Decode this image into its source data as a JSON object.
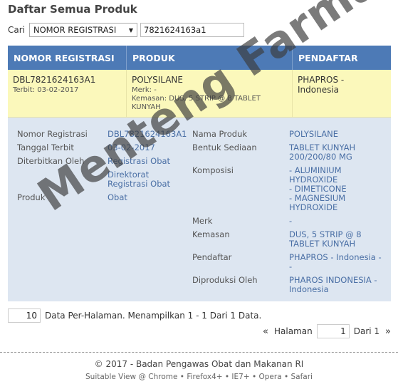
{
  "page_title": "Daftar Semua Produk",
  "search": {
    "label": "Cari",
    "field_selected": "NOMOR REGISTRASI",
    "query": "7821624163a1"
  },
  "table": {
    "headers": [
      "NOMOR REGISTRASI",
      "PRODUK",
      "PENDAFTAR"
    ],
    "row": {
      "reg_no": "DBL7821624163A1",
      "terbit": "Terbit: 03-02-2017",
      "product": "POLYSILANE",
      "merk": "Merk: -",
      "kemasan": "Kemasan: DUS, 5 STRIP @ 8 TABLET KUNYAH",
      "registrant": "PHAPROS -",
      "registrant_country": "Indonesia"
    }
  },
  "detail": {
    "left": {
      "nomor_label": "Nomor Registrasi",
      "nomor_value": "DBL7821624163A1",
      "tanggal_label": "Tanggal Terbit",
      "tanggal_value": "03-02-2017",
      "diterbitkan_label": "Diterbitkan Oleh",
      "diterbitkan_link1": "Registrasi Obat",
      "diterbitkan_link2": "Direktorat Registrasi Obat",
      "produk_label": "Produk",
      "produk_value": "Obat"
    },
    "right": {
      "nama_label": "Nama Produk",
      "nama_value": "POLYSILANE",
      "bentuk_label": "Bentuk Sediaan",
      "bentuk_value": "TABLET KUNYAH 200/200/80 MG",
      "komposisi_label": "Komposisi",
      "komposisi_1": "- ALUMINIUM HYDROXIDE",
      "komposisi_2": "- DIMETICONE",
      "komposisi_3": "- MAGNESIUM HYDROXIDE",
      "merk_label": "Merk",
      "merk_value": "-",
      "kemasan_label": "Kemasan",
      "kemasan_value": "DUS, 5 STRIP @ 8 TABLET KUNYAH",
      "pendaftar_label": "Pendaftar",
      "pendaftar_value": "PHAPROS - Indonesia - -",
      "diproduksi_label": "Diproduksi Oleh",
      "diproduksi_value": "PHAROS INDONESIA - Indonesia"
    }
  },
  "pagination": {
    "per_page": "10",
    "info": "Data Per-Halaman. Menampilkan 1 - 1 Dari 1 Data.",
    "prev": "«",
    "halaman_label": "Halaman",
    "current": "1",
    "of": "Dari 1",
    "next": "»"
  },
  "footer": {
    "line1": "© 2017 - Badan Pengawas Obat dan Makanan RI",
    "line2": "Suitable View @ Chrome • Firefox4+ • IE7+ • Opera • Safari"
  },
  "watermark": "Menteng Farma",
  "colors": {
    "header_bg": "#4d7ab6",
    "row_bg": "#fbf8bb",
    "detail_bg": "#dde6f1",
    "link": "#4a6fa5"
  }
}
